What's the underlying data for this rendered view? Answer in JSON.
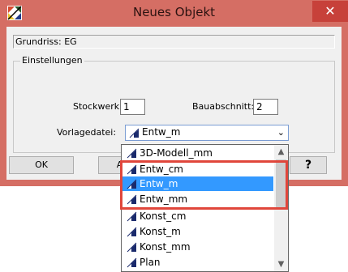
{
  "window": {
    "title": "Neues Objekt",
    "close_label": "✕"
  },
  "grundriss": "Grundriss: EG",
  "settings": {
    "legend": "Einstellungen",
    "stockwerk_label": "Stockwerk:",
    "stockwerk_value": "1",
    "bauabschnitt_label": "Bauabschnitt:",
    "bauabschnitt_value": "2",
    "vorlage_label": "Vorlagedatei:",
    "vorlage_value": "Entw_m"
  },
  "buttons": {
    "ok": "OK",
    "abbrechen": "Ab",
    "help": "?"
  },
  "dropdown": {
    "items": [
      "3D-Modell_mm",
      "Entw_cm",
      "Entw_m",
      "Entw_mm",
      "Konst_cm",
      "Konst_m",
      "Konst_mm",
      "Plan"
    ],
    "selected": "Entw_m"
  },
  "colors": {
    "selection": "#3399ff",
    "highlight": "#e0463b",
    "titlebar": "#d56e64"
  }
}
